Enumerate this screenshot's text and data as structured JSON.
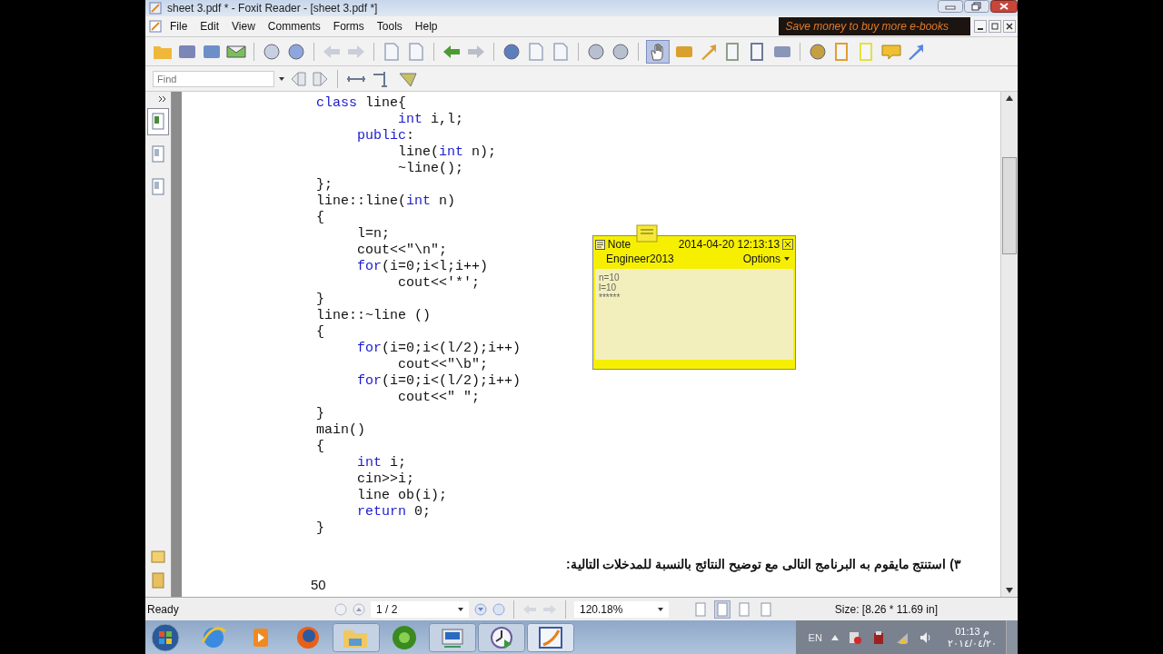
{
  "window": {
    "title": "sheet 3.pdf * - Foxit Reader - [sheet 3.pdf *]"
  },
  "menu": [
    "File",
    "Edit",
    "View",
    "Comments",
    "Forms",
    "Tools",
    "Help"
  ],
  "ad_banner": "Save money to buy more e-books",
  "hand_tool": {
    "selected": true
  },
  "find": {
    "placeholder": "Find"
  },
  "nav_tabs": [
    {
      "selected": true
    },
    {
      "selected": false
    },
    {
      "selected": false
    }
  ],
  "code": [
    [
      {
        "text": "class",
        "kw": true
      },
      {
        "text": " line{",
        "kw": false
      }
    ],
    [
      {
        "text": "          int",
        "kw": true
      },
      {
        "text": " i,l;",
        "kw": false
      }
    ],
    [
      {
        "text": "     public",
        "kw": true
      },
      {
        "text": ":",
        "kw": false
      }
    ],
    [
      {
        "text": "          line(",
        "kw": false
      },
      {
        "text": "int",
        "kw": true
      },
      {
        "text": " n);",
        "kw": false
      }
    ],
    [
      {
        "text": "          ~line();",
        "kw": false
      }
    ],
    [
      {
        "text": "};",
        "kw": false
      }
    ],
    [
      {
        "text": "line::line(",
        "kw": false
      },
      {
        "text": "int",
        "kw": true
      },
      {
        "text": " n)",
        "kw": false
      }
    ],
    [
      {
        "text": "{",
        "kw": false
      }
    ],
    [
      {
        "text": "     l=n;",
        "kw": false
      }
    ],
    [
      {
        "text": "     cout<<\"\\n\";",
        "kw": false
      }
    ],
    [
      {
        "text": "     for",
        "kw": true
      },
      {
        "text": "(i=0;i<l;i++)",
        "kw": false
      }
    ],
    [
      {
        "text": "          cout<<'*';",
        "kw": false
      }
    ],
    [
      {
        "text": "}",
        "kw": false
      }
    ],
    [
      {
        "text": "line::~line ()",
        "kw": false
      }
    ],
    [
      {
        "text": "{",
        "kw": false
      }
    ],
    [
      {
        "text": "     for",
        "kw": true
      },
      {
        "text": "(i=0;i<(l/2);i++)",
        "kw": false
      }
    ],
    [
      {
        "text": "          cout<<\"\\b\";",
        "kw": false
      }
    ],
    [
      {
        "text": "     for",
        "kw": true
      },
      {
        "text": "(i=0;i<(l/2);i++)",
        "kw": false
      }
    ],
    [
      {
        "text": "          cout<<\" \";",
        "kw": false
      }
    ],
    [
      {
        "text": "}",
        "kw": false
      }
    ],
    [
      {
        "text": "main()",
        "kw": false
      }
    ],
    [
      {
        "text": "{",
        "kw": false
      }
    ],
    [
      {
        "text": "     int",
        "kw": true
      },
      {
        "text": " i;",
        "kw": false
      }
    ],
    [
      {
        "text": "     cin>>i;",
        "kw": false
      }
    ],
    [
      {
        "text": "     line ob(i);",
        "kw": false
      }
    ],
    [
      {
        "text": "     return",
        "kw": true
      },
      {
        "text": " 0;",
        "kw": false
      }
    ],
    [
      {
        "text": "}",
        "kw": false
      }
    ]
  ],
  "question": "٣)  استنتج مايقوم به البرنامج التالى مع توضيح النتائج بالنسبة للمدخلات التالية:",
  "page_label": "50",
  "note": {
    "title": "Note",
    "date": "2014-04-20 12:13:13",
    "author": "Engineer2013",
    "options": "Options",
    "lines": [
      "n=10",
      "l=10",
      "******"
    ]
  },
  "status_bar": {
    "status": "Ready",
    "page": "1 / 2",
    "zoom": "120.18%",
    "view_modes": [
      {
        "selected": false
      },
      {
        "selected": true
      },
      {
        "selected": false
      },
      {
        "selected": false
      }
    ],
    "size": "Size: [8.26 * 11.69 in]"
  },
  "taskbar": {
    "language": "EN",
    "time": "01:13 م",
    "date": "٢٠١٤/٠٤/٢٠"
  }
}
